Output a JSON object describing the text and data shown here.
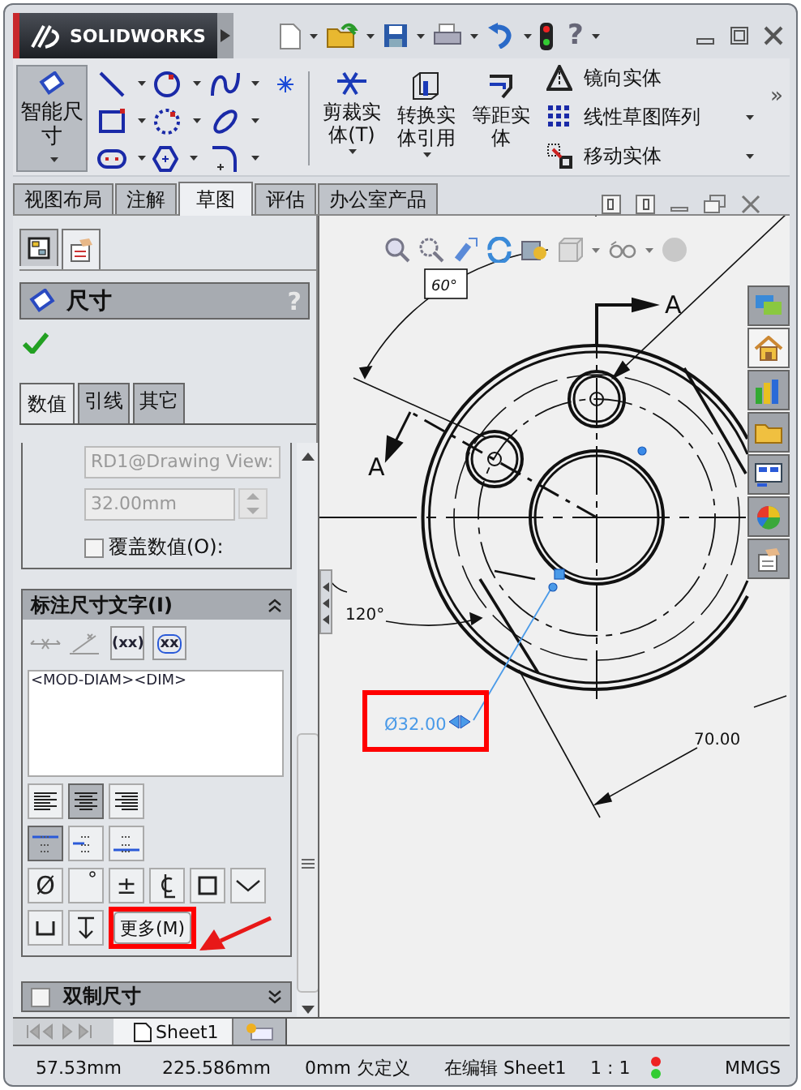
{
  "title_bar": {
    "logo": "SOLIDWORKS",
    "help": "?"
  },
  "ribbon": {
    "smart_dimension": {
      "label": "智能尺寸",
      "selected": true
    },
    "large_tools": [
      "剪裁实体(T)",
      "转换实体引用",
      "等距实体"
    ],
    "list_tools": [
      "镜向实体",
      "线性草图阵列",
      "移动实体"
    ],
    "more": "»"
  },
  "tabs": [
    {
      "label": "视图布局",
      "selected": false
    },
    {
      "label": "注解",
      "selected": false
    },
    {
      "label": "草图",
      "selected": true
    },
    {
      "label": "评估",
      "selected": false
    },
    {
      "label": "办公室产品",
      "selected": false
    }
  ],
  "property_manager": {
    "title": "尺寸",
    "help": "?",
    "tabs": [
      {
        "label": "数值",
        "selected": true
      },
      {
        "label": "引线",
        "selected": false
      },
      {
        "label": "其它",
        "selected": false
      }
    ],
    "name_field": "RD1@Drawing View:",
    "value_field": "32.00mm",
    "override": {
      "label": "覆盖数值(O):",
      "checked": false
    },
    "dimension_text": {
      "title": "标注尺寸文字(I)",
      "paren_buttons": [
        "(xx)",
        "xx"
      ],
      "text": "<MOD-DIAM><DIM>",
      "alignment": [
        {
          "selected": false
        },
        {
          "selected": true
        },
        {
          "selected": false
        }
      ],
      "arrow_layout": [
        {
          "selected": true
        },
        {
          "selected": false
        },
        {
          "selected": false
        }
      ],
      "symbols": [
        "Ø",
        "°",
        "±"
      ],
      "more_button": "更多(M)"
    },
    "dual_dimension": {
      "label": "双制尺寸",
      "checked": false
    }
  },
  "drawing": {
    "angle_top": "60°",
    "section_right": "A",
    "section_left": "A",
    "angle_left": "120°",
    "linear": "70.00",
    "selected_dimension": "Ø32.00"
  },
  "task_pane": [
    {
      "selected": false
    },
    {
      "selected": true
    },
    {
      "selected": false
    },
    {
      "selected": false
    },
    {
      "selected": false
    },
    {
      "selected": false
    },
    {
      "selected": false
    }
  ],
  "sheet_tabs": [
    {
      "label": "Sheet1",
      "selected": true
    }
  ],
  "status_bar": [
    "57.53mm",
    "225.586mm",
    "0mm",
    "欠定义",
    "在编辑 Sheet1",
    "1 : 1",
    "MMGS"
  ]
}
